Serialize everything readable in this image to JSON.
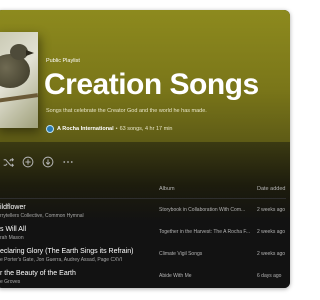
{
  "playlist": {
    "kind": "Public Playlist",
    "title": "Creation Songs",
    "description": "Songs that celebrate the Creator God and the world he has made.",
    "owner": "A Rocha International",
    "separator": "•",
    "stats": "63 songs, 4 hr 17 min"
  },
  "actions": {
    "shuffle_icon": "shuffle-icon",
    "add_icon": "add-circle-icon",
    "download_icon": "download-icon",
    "more_icon": "more-icon"
  },
  "columns": {
    "album": "Album",
    "date_added": "Date added"
  },
  "tracks": [
    {
      "title": "ildflower",
      "artist": "rrytellers Collective, Common Hymnal",
      "album": "Storybook in Collaboration With Com...",
      "date": "2 weeks ago"
    },
    {
      "title": "s Will All",
      "artist": "rah Mason",
      "album": "Together in the Harvest: The A Rocha F...",
      "date": "2 weeks ago"
    },
    {
      "title": "eclaring Glory (The Earth Sings its Refrain)",
      "artist": "e Porter's Gate, Jon Guerra, Audrey Assad, Page CXVI",
      "album": "Climate Vigil Songs",
      "date": "2 weeks ago"
    },
    {
      "title": "r the Beauty of the Earth",
      "artist": "e Groves",
      "album": "Abide With Me",
      "date": "6 days ago"
    }
  ],
  "colors": {
    "hero": "#8d8a1e",
    "background": "#121212"
  }
}
